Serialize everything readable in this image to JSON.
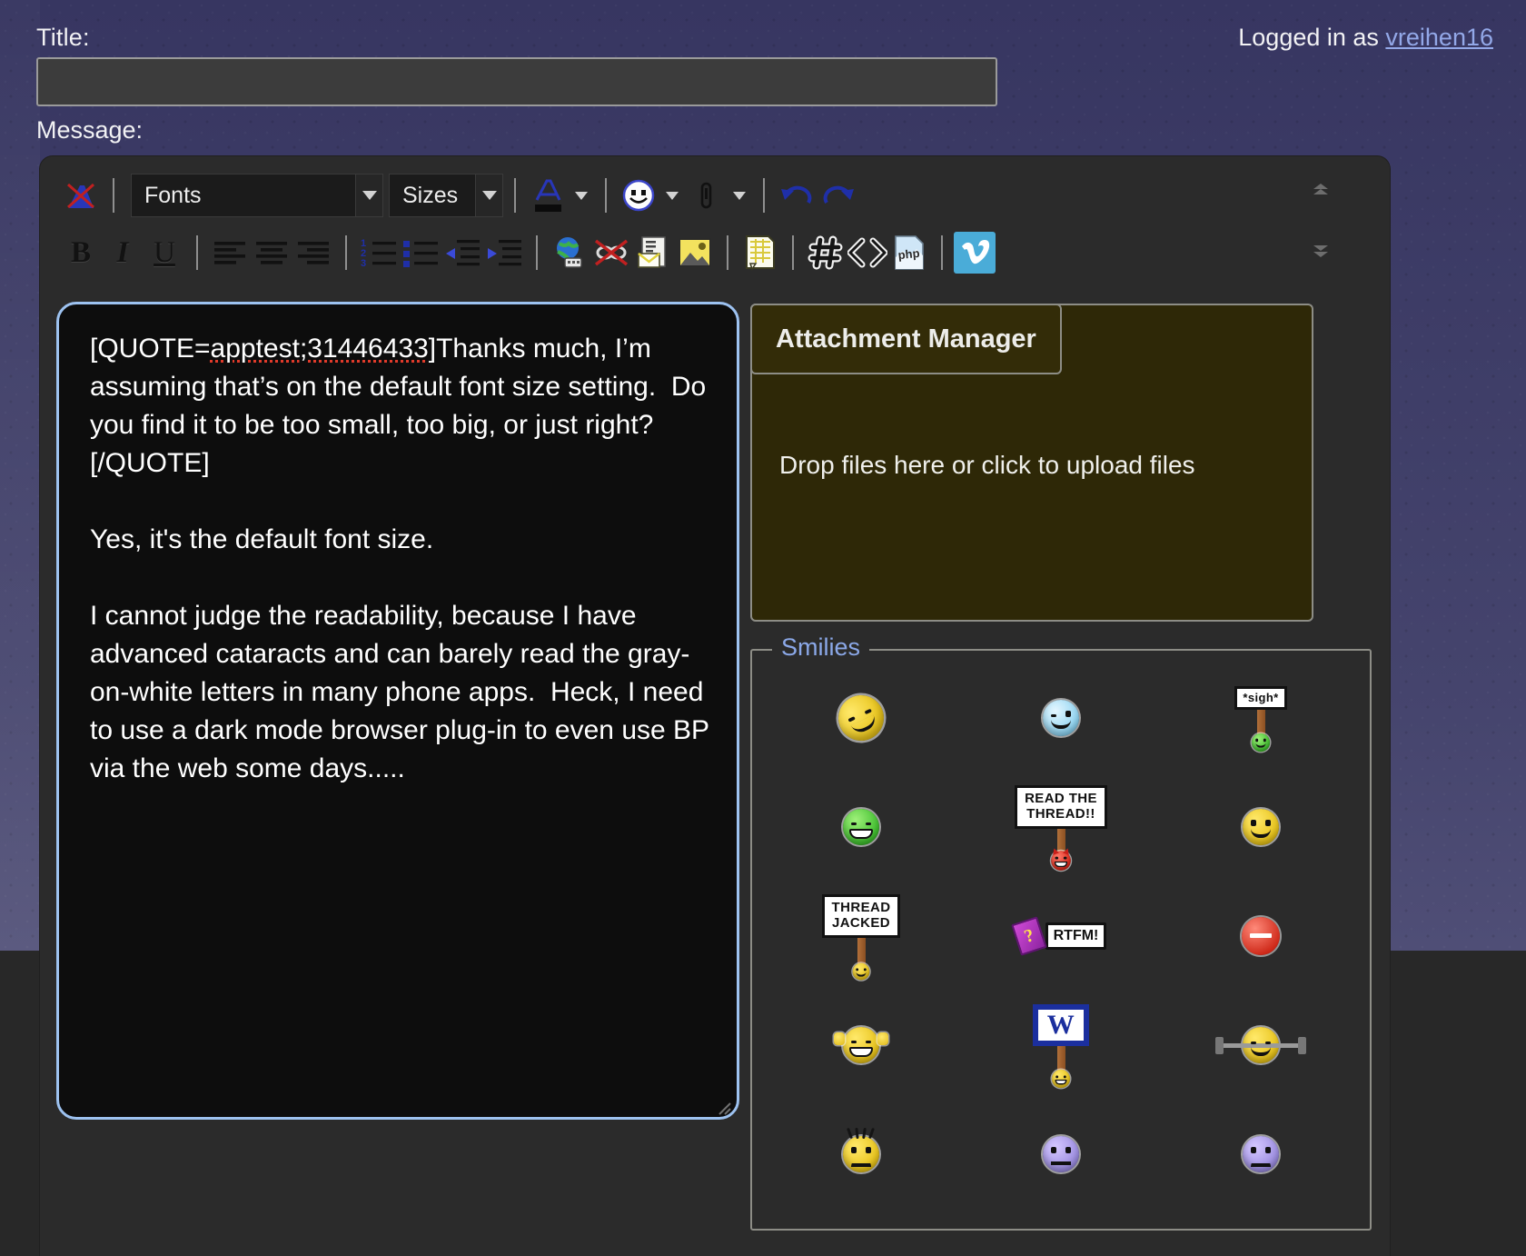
{
  "header": {
    "title_label": "Title:",
    "title_value": "",
    "title_placeholder": "",
    "logged_in_prefix": "Logged in as ",
    "username": "vreihen16",
    "message_label": "Message:"
  },
  "colors": {
    "page_background": "#3b3a62",
    "editor_background": "#2b2b2b",
    "textarea_background": "#0d0d0d",
    "textarea_border": "#9dc2f0",
    "attachment_background": "#2e2807",
    "link": "#93a8e8",
    "legend": "#8ba8e8",
    "vimeo_blue": "#4aacd8",
    "spellcheck_underline": "#e03a2a"
  },
  "toolbar": {
    "row1": [
      {
        "name": "remove-formatting-icon",
        "label": "Remove Formatting"
      },
      {
        "name": "font-family-select",
        "label": "Fonts"
      },
      {
        "name": "font-size-select",
        "label": "Sizes"
      },
      {
        "name": "font-color-icon",
        "label": "Font Color"
      },
      {
        "name": "smilie-icon",
        "label": "Insert Smilie"
      },
      {
        "name": "attachment-icon",
        "label": "Insert Attachment"
      },
      {
        "name": "undo-icon",
        "label": "Undo"
      },
      {
        "name": "redo-icon",
        "label": "Redo"
      }
    ],
    "fonts_label": "Fonts",
    "sizes_label": "Sizes",
    "row2": [
      {
        "name": "bold-button",
        "label": "B"
      },
      {
        "name": "italic-button",
        "label": "I"
      },
      {
        "name": "underline-button",
        "label": "U"
      },
      {
        "name": "align-left-icon",
        "label": "Align Left"
      },
      {
        "name": "align-center-icon",
        "label": "Align Center"
      },
      {
        "name": "align-right-icon",
        "label": "Align Right"
      },
      {
        "name": "ordered-list-icon",
        "label": "Numbered List"
      },
      {
        "name": "unordered-list-icon",
        "label": "Bulleted List"
      },
      {
        "name": "outdent-icon",
        "label": "Decrease Indent"
      },
      {
        "name": "indent-icon",
        "label": "Increase Indent"
      },
      {
        "name": "insert-link-icon",
        "label": "Insert Link"
      },
      {
        "name": "remove-link-icon",
        "label": "Remove Link"
      },
      {
        "name": "insert-email-icon",
        "label": "Insert Email"
      },
      {
        "name": "insert-image-icon",
        "label": "Insert Image"
      },
      {
        "name": "insert-quote-icon",
        "label": "Insert Quote"
      },
      {
        "name": "insert-hash-icon",
        "label": "Wrap Tags"
      },
      {
        "name": "insert-code-icon",
        "label": "Code"
      },
      {
        "name": "insert-php-icon",
        "label": "PHP Code"
      },
      {
        "name": "insert-vimeo-icon",
        "label": "Vimeo"
      }
    ],
    "scroll_up_label": "»",
    "scroll_down_label": "»"
  },
  "message": {
    "quote_open": "[QUOTE=",
    "quote_ref": "apptest;31446433",
    "quote_rest": "]Thanks much, I’m assuming that’s on the default font size setting.  Do you find it to be too small, too big, or just right?[/QUOTE]",
    "body": "\n\nYes, it's the default font size.\n\nI cannot judge the readability, because I have advanced cataracts and can barely read the gray-on-white letters in many phone apps.  Heck, I need to use a dark mode browser plug-in to even use BP via the web some days....."
  },
  "attachment": {
    "header": "Attachment Manager",
    "drop_text": "Drop files here or click to upload files"
  },
  "smilies": {
    "legend": "Smilies",
    "items": [
      {
        "name": "smiley-sleeping",
        "alt": "sleeping"
      },
      {
        "name": "smiley-blue-wink",
        "alt": "blue wink"
      },
      {
        "name": "smiley-sigh-sign",
        "alt": "*sigh*",
        "sign_text": "*sigh*"
      },
      {
        "name": "smiley-green-grin",
        "alt": "green grin"
      },
      {
        "name": "smiley-read-the-thread-sign",
        "alt": "Read The Thread!!",
        "sign_text": "READ THE\nTHREAD!!"
      },
      {
        "name": "smiley-yellow-smile",
        "alt": "smile"
      },
      {
        "name": "smiley-thread-jacked-sign",
        "alt": "Thread Jacked",
        "sign_text": "THREAD\nJACKED"
      },
      {
        "name": "smiley-rtfm",
        "alt": "RTFM!",
        "sign_text": "RTFM!"
      },
      {
        "name": "smiley-stop",
        "alt": "stop"
      },
      {
        "name": "smiley-applause",
        "alt": "applause"
      },
      {
        "name": "smiley-welcome-sign",
        "alt": "W",
        "sign_text": "W"
      },
      {
        "name": "smiley-weightlifter",
        "alt": "weightlifter"
      },
      {
        "name": "smiley-angry-hair",
        "alt": "angry"
      },
      {
        "name": "smiley-violet-neutral",
        "alt": "neutral"
      },
      {
        "name": "smiley-violet-sad",
        "alt": "sad"
      }
    ]
  }
}
